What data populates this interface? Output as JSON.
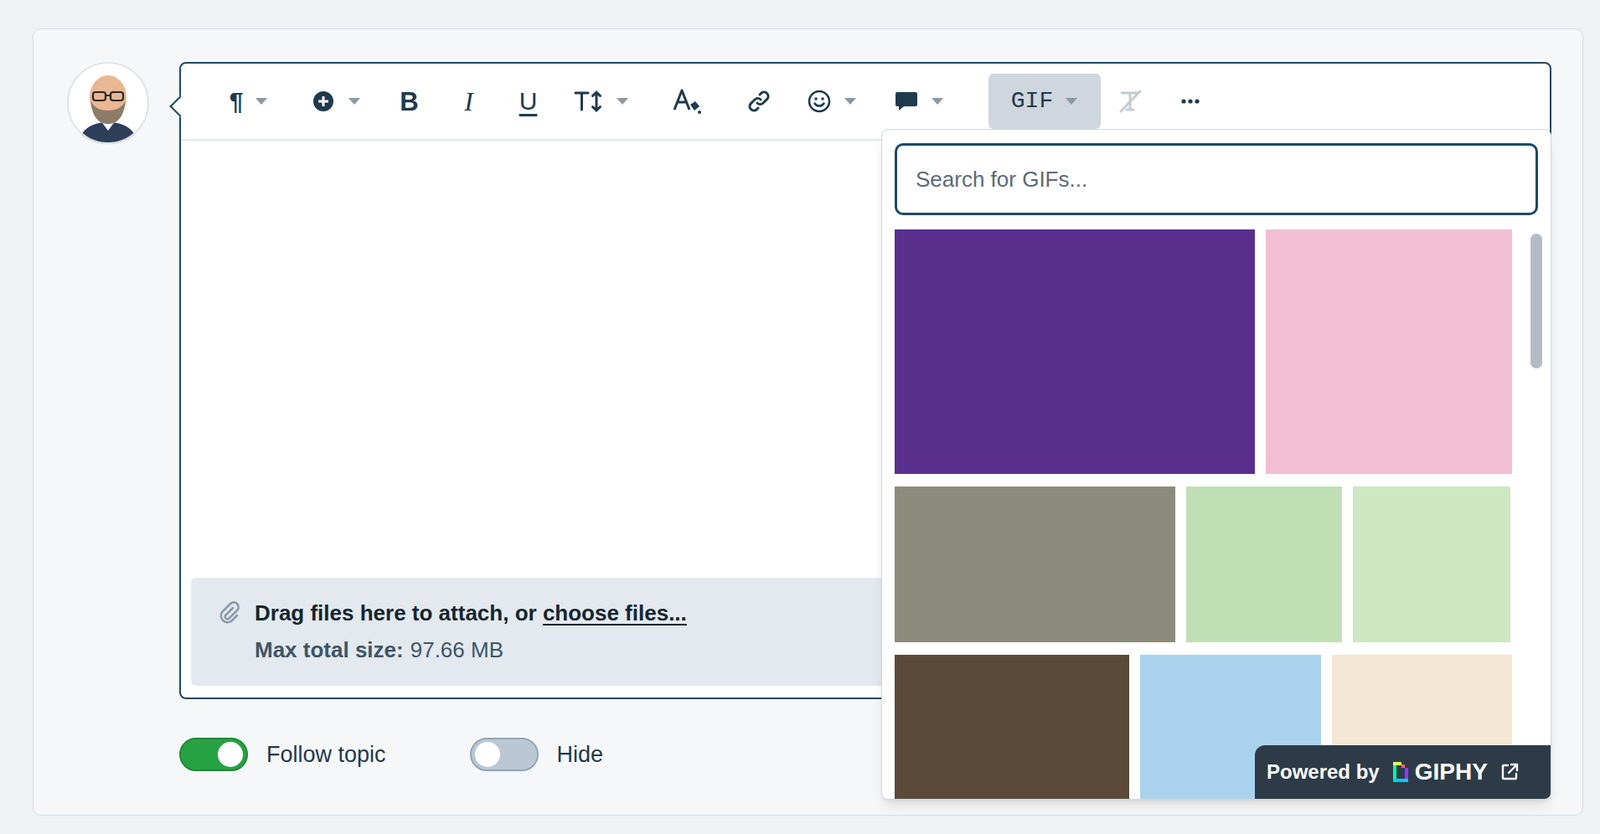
{
  "editor": {
    "toolbar": [
      {
        "kind": "text",
        "label": "¶",
        "dropdown": true,
        "selected": false,
        "disabled": false
      },
      {
        "kind": "icon",
        "dropdown": true,
        "selected": false,
        "disabled": false
      },
      {
        "kind": "text",
        "label": "B",
        "dropdown": false,
        "selected": false,
        "disabled": false
      },
      {
        "kind": "text",
        "label": "I",
        "dropdown": false,
        "selected": false,
        "disabled": false
      },
      {
        "kind": "text",
        "label": "U",
        "dropdown": false,
        "selected": false,
        "disabled": false
      },
      {
        "kind": "icon",
        "dropdown": true,
        "selected": false,
        "disabled": false
      },
      {
        "kind": "icon",
        "dropdown": false,
        "selected": false,
        "disabled": false
      },
      {
        "kind": "icon",
        "dropdown": false,
        "selected": false,
        "disabled": false
      },
      {
        "kind": "icon",
        "dropdown": true,
        "selected": false,
        "disabled": false
      },
      {
        "kind": "icon",
        "dropdown": true,
        "selected": false,
        "disabled": false
      },
      {
        "kind": "text",
        "label": "GIF",
        "dropdown": true,
        "selected": true,
        "disabled": false
      },
      {
        "kind": "icon",
        "dropdown": false,
        "selected": false,
        "disabled": true
      },
      {
        "kind": "icon",
        "dropdown": false,
        "selected": false,
        "disabled": false
      }
    ],
    "attachments": {
      "text": "Drag files here to attach, or ",
      "link": "choose files...",
      "max_label": "Max total size:",
      "max_value": "97.66 MB"
    }
  },
  "options": [
    {
      "label": "Follow topic",
      "on": true
    },
    {
      "label": "Hide",
      "on": false
    }
  ],
  "gif_picker": {
    "search": {
      "placeholder": "Search for GIFs..."
    },
    "results": [
      [
        {
          "color": "#5b2f8e"
        },
        {
          "color": "#f2bfd2"
        }
      ],
      [
        {
          "color": "#8c8a7a"
        },
        {
          "color": "#bfe0b5"
        },
        {
          "color": "#cde8c0"
        }
      ],
      [
        {
          "color": "#5b4a3a"
        },
        {
          "color": "#a9d3ec"
        },
        {
          "color": "#f4e7d6"
        }
      ]
    ],
    "scrollbar": {
      "level": 0.24
    },
    "attribution": {
      "prefix": "Powered by",
      "brand": "GIPHY"
    }
  }
}
